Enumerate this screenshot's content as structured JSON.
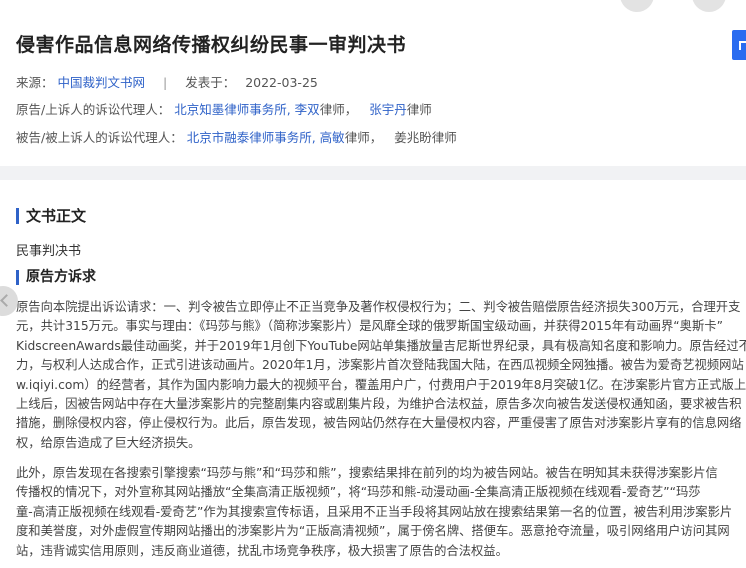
{
  "header": {
    "title": "侵害作品信息网络传播权纠纷民事一审判决书",
    "source_label": "来源：",
    "source_value": "中国裁判文书网",
    "date_label": "发表于：",
    "date_value": "2022-03-25",
    "plaintiff_agents_label": "原告/上诉人的诉讼代理人：",
    "plaintiff_firm": "北京知墨律师事务所,",
    "plaintiff_lawyer1": "李双",
    "plaintiff_lawyer1_suffix": "律师，",
    "plaintiff_lawyer2": "张宇丹",
    "plaintiff_lawyer2_suffix": "律师",
    "defendant_agents_label": "被告/被上诉人的诉讼代理人：",
    "defendant_firm": "北京市融泰律师事务所,",
    "defendant_lawyer1": "高敏",
    "defendant_lawyer1_suffix": "律师，",
    "defendant_lawyer2": "姜兆盼律师"
  },
  "document": {
    "section_title": "文书正文",
    "doc_type": "民事判决书",
    "claims_title": "原告方诉求",
    "paragraph1": [
      "原告向本院提出诉讼请求：一、判令被告立即停止不正当竞争及著作权侵权行为；二、判令被告赔偿原告经济损失300万元，合理开支",
      "元，共计315万元。事实与理由：《玛莎与熊》（简称涉案影片）是风靡全球的俄罗斯国宝级动画，并获得2015年有动画界“奥斯卡”",
      "KidscreenAwards最佳动画奖，并于2019年1月创下YouTube网站单集播放量吉尼斯世界纪录，具有极高知名度和影响力。原告经过不",
      "力，与权利人达成合作，正式引进该动画片。2020年1月，涉案影片首次登陆我国大陆，在西瓜视频全网独播。被告为爱奇艺视频网站",
      "w.iqiyi.com）的经营者，其作为国内影响力最大的视频平台，覆盖用户广，付费用户于2019年8月突破1亿。在涉案影片官方正式版上",
      "上线后，因被告网站中存在大量涉案影片的完整剧集内容或剧集片段，为维护合法权益，原告多次向被告发送侵权通知函，要求被告积",
      "措施，删除侵权内容，停止侵权行为。此后，原告发现，被告网站仍然存在大量侵权内容，严重侵害了原告对涉案影片享有的信息网络",
      "权，给原告造成了巨大经济损失。"
    ],
    "paragraph2": [
      "此外，原告发现在各搜索引擎搜索“玛莎与熊”和“玛莎和熊”，搜索结果排在前列的均为被告网站。被告在明知其未获得涉案影片信",
      "传播权的情况下，对外宣称其网站播放“全集高清正版视频”，将“玛莎和熊-动漫动画-全集高清正版视频在线观看-爱奇艺”“玛莎",
      "童-高清正版视频在线观看-爱奇艺”作为其搜索宣传标语，且采用不正当手段将其网站放在搜索结果第一名的位置，被告利用涉案影片",
      "度和美誉度，对外虚假宣传期网站播出的涉案影片为“正版高清视频”，属于傍名牌、搭便车。恶意抢夺流量，吸引网络用户访问其网",
      "站，违背诚实信用原则，违反商业道德，扰乱市场竞争秩序，极大损害了原告的合法权益。"
    ]
  }
}
